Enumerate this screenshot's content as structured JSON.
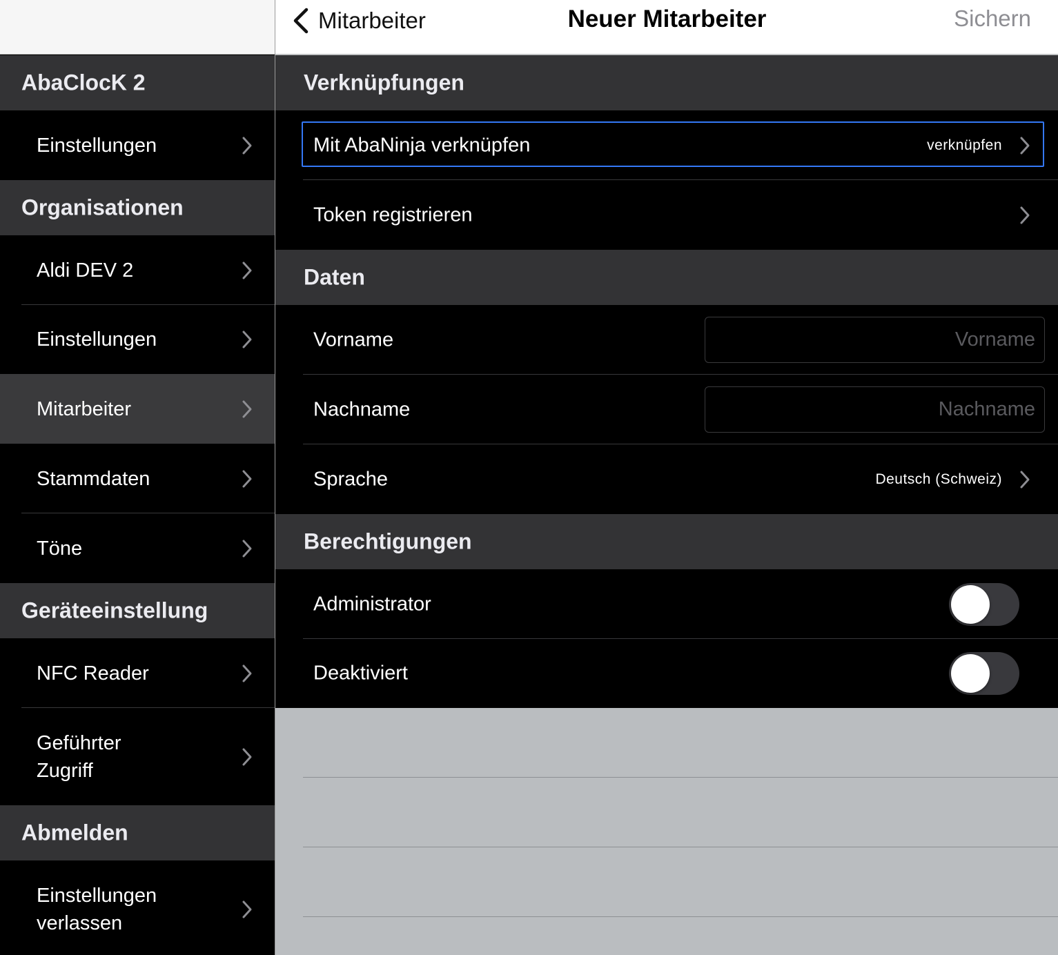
{
  "sidebar": {
    "sections": [
      {
        "title": "AbaClocK 2",
        "items": [
          {
            "label": "Einstellungen"
          }
        ]
      },
      {
        "title": "Organisationen",
        "items": [
          {
            "label": "Aldi DEV 2"
          },
          {
            "label": "Einstellungen"
          },
          {
            "label": "Mitarbeiter",
            "selected": true
          },
          {
            "label": "Stammdaten"
          },
          {
            "label": "Töne"
          }
        ]
      },
      {
        "title": "Geräteeinstellung",
        "items": [
          {
            "label": "NFC Reader"
          },
          {
            "label": "Geführter Zugriff"
          }
        ]
      },
      {
        "title": "Abmelden",
        "items": [
          {
            "label": "Einstellungen verlassen"
          }
        ]
      }
    ]
  },
  "navbar": {
    "back_label": "Mitarbeiter",
    "title": "Neuer Mitarbeiter",
    "save_label": "Sichern"
  },
  "detail": {
    "links": {
      "title": "Verknüpfungen",
      "abaninja": {
        "label": "Mit AbaNinja verknüpfen",
        "value": "verknüpfen"
      },
      "token": {
        "label": "Token registrieren"
      }
    },
    "data": {
      "title": "Daten",
      "firstname": {
        "label": "Vorname",
        "value": "",
        "placeholder": "Vorname"
      },
      "lastname": {
        "label": "Nachname",
        "value": "",
        "placeholder": "Nachname"
      },
      "language": {
        "label": "Sprache",
        "value": "Deutsch (Schweiz)"
      }
    },
    "permissions": {
      "title": "Berechtigungen",
      "admin": {
        "label": "Administrator",
        "on": false
      },
      "disabled": {
        "label": "Deaktiviert",
        "on": false
      }
    }
  },
  "colors": {
    "accent": "#3478f6",
    "section_bg": "#333335",
    "row_bg": "#000000",
    "empty_bg": "#babdc0"
  }
}
